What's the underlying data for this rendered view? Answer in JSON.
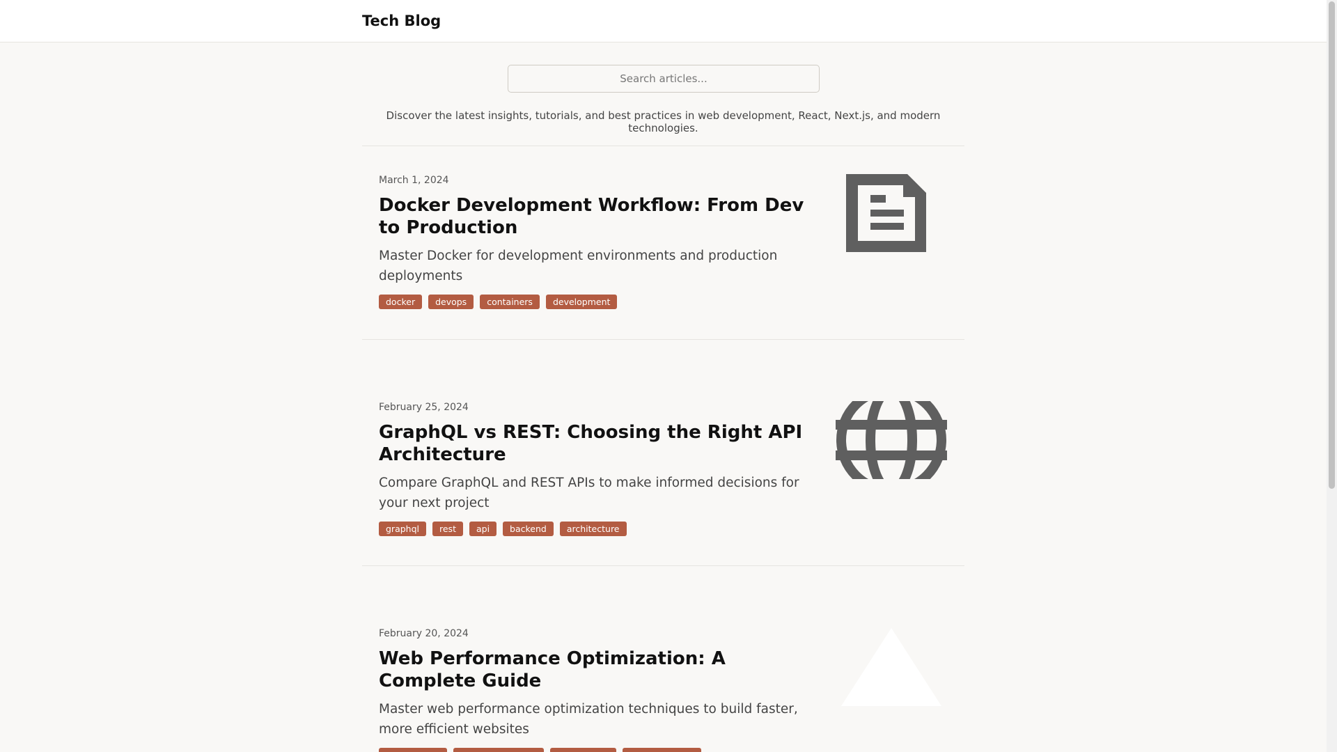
{
  "header": {
    "brand": "Tech Blog"
  },
  "search": {
    "placeholder": "Search articles..."
  },
  "intro": "Discover the latest insights, tutorials, and best practices in web development, React, Next.js, and modern technologies.",
  "posts": [
    {
      "date": "March 1, 2024",
      "title": "Docker Development Workflow: From Dev to Production",
      "description": "Master Docker for development environments and production deployments",
      "tags": [
        "docker",
        "devops",
        "containers",
        "development"
      ],
      "icon": "document-icon"
    },
    {
      "date": "February 25, 2024",
      "title": "GraphQL vs REST: Choosing the Right API Architecture",
      "description": "Compare GraphQL and REST APIs to make informed decisions for your next project",
      "tags": [
        "graphql",
        "rest",
        "api",
        "backend",
        "architecture"
      ],
      "icon": "globe-icon"
    },
    {
      "date": "February 20, 2024",
      "title": "Web Performance Optimization: A Complete Guide",
      "description": "Master web performance optimization techniques to build faster, more efficient websites",
      "tags": [
        "",
        "",
        "",
        ""
      ],
      "icon": "triangle-icon"
    }
  ],
  "colors": {
    "tag_bg": "#b35c42",
    "icon": "#5f5f5f",
    "page_bg": "#f9f8f6"
  }
}
